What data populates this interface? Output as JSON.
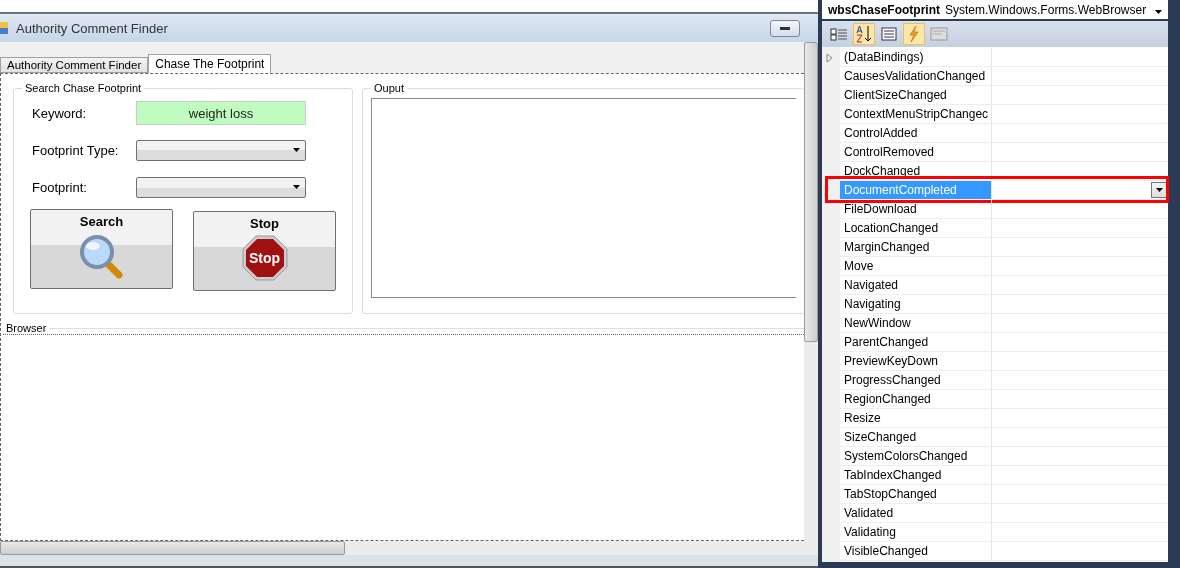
{
  "window": {
    "title": "Authority Comment Finder"
  },
  "tabs": [
    {
      "label": "Authority Comment Finder",
      "selected": false
    },
    {
      "label": "Chase The Footprint",
      "selected": true
    }
  ],
  "search_group": {
    "title": "Search Chase Footprint",
    "fields": [
      {
        "kind": "text",
        "label": "Keyword:",
        "value": "weight loss"
      },
      {
        "kind": "combo",
        "label": "Footprint Type:"
      },
      {
        "kind": "combo",
        "label": "Footprint:"
      }
    ],
    "buttons": [
      {
        "kind": "search",
        "label": "Search"
      },
      {
        "kind": "stop",
        "label": "Stop",
        "icon_text": "Stop"
      }
    ]
  },
  "output_group": {
    "title": "Ouput"
  },
  "browser_group": {
    "title": "Browser"
  },
  "properties": {
    "object_name": "wbsChaseFootprint",
    "object_type": "System.Windows.Forms.WebBrowser",
    "toolbar": [
      {
        "kind": "categorized",
        "selected": false
      },
      {
        "kind": "alphabetical",
        "selected": true
      },
      {
        "kind": "properties",
        "selected": false
      },
      {
        "kind": "events",
        "selected": true
      },
      {
        "kind": "pages",
        "selected": false
      }
    ],
    "rows": [
      {
        "name": "(DataBindings)",
        "expandable": true,
        "selected": false
      },
      {
        "name": "CausesValidationChanged",
        "expandable": false,
        "selected": false
      },
      {
        "name": "ClientSizeChanged",
        "expandable": false,
        "selected": false
      },
      {
        "name": "ContextMenuStripChangec",
        "expandable": false,
        "selected": false
      },
      {
        "name": "ControlAdded",
        "expandable": false,
        "selected": false
      },
      {
        "name": "ControlRemoved",
        "expandable": false,
        "selected": false
      },
      {
        "name": "DockChanged",
        "expandable": false,
        "selected": false
      },
      {
        "name": "DocumentCompleted",
        "expandable": false,
        "selected": true
      },
      {
        "name": "FileDownload",
        "expandable": false,
        "selected": false
      },
      {
        "name": "LocationChanged",
        "expandable": false,
        "selected": false
      },
      {
        "name": "MarginChanged",
        "expandable": false,
        "selected": false
      },
      {
        "name": "Move",
        "expandable": false,
        "selected": false
      },
      {
        "name": "Navigated",
        "expandable": false,
        "selected": false
      },
      {
        "name": "Navigating",
        "expandable": false,
        "selected": false
      },
      {
        "name": "NewWindow",
        "expandable": false,
        "selected": false
      },
      {
        "name": "ParentChanged",
        "expandable": false,
        "selected": false
      },
      {
        "name": "PreviewKeyDown",
        "expandable": false,
        "selected": false
      },
      {
        "name": "ProgressChanged",
        "expandable": false,
        "selected": false
      },
      {
        "name": "RegionChanged",
        "expandable": false,
        "selected": false
      },
      {
        "name": "Resize",
        "expandable": false,
        "selected": false
      },
      {
        "name": "SizeChanged",
        "expandable": false,
        "selected": false
      },
      {
        "name": "SystemColorsChanged",
        "expandable": false,
        "selected": false
      },
      {
        "name": "TabIndexChanged",
        "expandable": false,
        "selected": false
      },
      {
        "name": "TabStopChanged",
        "expandable": false,
        "selected": false
      },
      {
        "name": "Validated",
        "expandable": false,
        "selected": false
      },
      {
        "name": "Validating",
        "expandable": false,
        "selected": false
      },
      {
        "name": "VisibleChanged",
        "expandable": false,
        "selected": false
      }
    ]
  }
}
